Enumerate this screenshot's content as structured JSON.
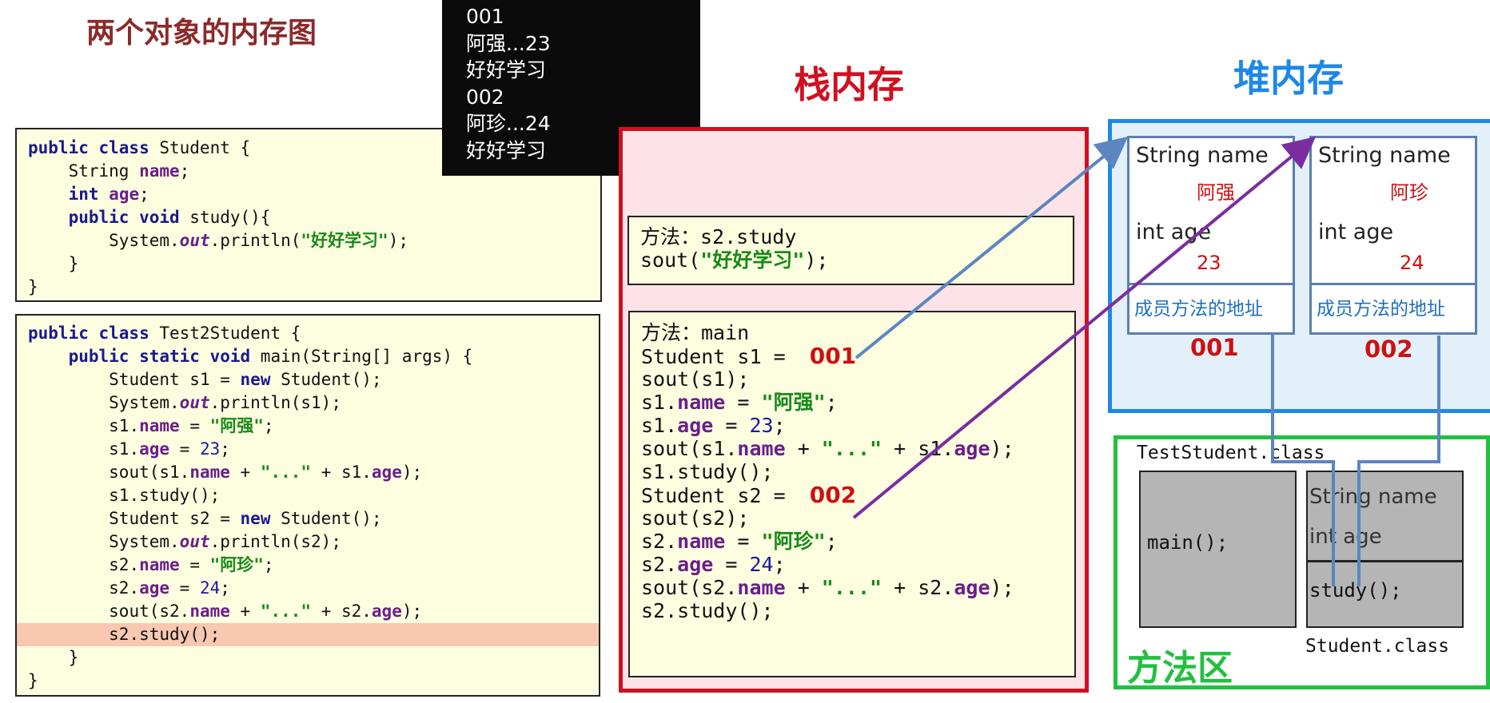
{
  "title": "两个对象的内存图",
  "console_lines": [
    "001",
    "阿强...23",
    "好好学习",
    "002",
    "阿珍...24",
    "好好学习"
  ],
  "code_student": {
    "l1_kw": "public class",
    "l1_name": " Student {",
    "l2_type": "String ",
    "l2_field": "name",
    "l2_end": ";",
    "l3_type": "int",
    "l3_field": "age",
    "l3_end": ";",
    "l4_kw": "public void",
    "l4_rest": " study(){",
    "l5_a": "System.",
    "l5_out": "out",
    "l5_b": ".println(",
    "l5_str": "\"好好学习\"",
    "l5_end": ");",
    "l6": "}",
    "l7": "}"
  },
  "code_test": {
    "l1_kw": "public class",
    "l1_name": " Test2Student {",
    "l2_kw": "public static void",
    "l2_rest": " main(String[] args) {",
    "l3_a": "Student s1 = ",
    "l3_kw": "new",
    "l3_b": " Student();",
    "l4_a": "System.",
    "l4_out": "out",
    "l4_b": ".println(s1);",
    "l5_a": "s1.",
    "l5_f": "name",
    "l5_b": " = ",
    "l5_s": "\"阿强\"",
    "l5_end": ";",
    "l6_a": "s1.",
    "l6_f": "age",
    "l6_b": " = ",
    "l6_n": "23",
    "l6_end": ";",
    "l7_a": "sout(s1.",
    "l7_f": "name",
    "l7_b": " + ",
    "l7_s": "\"...\"",
    "l7_c": " + s1.",
    "l7_f2": "age",
    "l7_end": ");",
    "l8": "s1.study();",
    "l9_a": "Student s2 = ",
    "l9_kw": "new",
    "l9_b": " Student();",
    "l10_a": "System.",
    "l10_out": "out",
    "l10_b": ".println(s2);",
    "l11_a": "s2.",
    "l11_f": "name",
    "l11_b": " = ",
    "l11_s": "\"阿珍\"",
    "l11_end": ";",
    "l12_a": "s2.",
    "l12_f": "age",
    "l12_b": " = ",
    "l12_n": "24",
    "l12_end": ";",
    "l13_a": "sout(s2.",
    "l13_f": "name",
    "l13_b": " + ",
    "l13_s": "\"...\"",
    "l13_c": " + s2.",
    "l13_f2": "age",
    "l13_end": ");",
    "l14": "s2.study();",
    "l15": "}",
    "l16": "}"
  },
  "stack": {
    "title": "栈内存",
    "frame_study": {
      "l1": "方法：s2.study",
      "l2_a": "sout(",
      "l2_s": "\"好好学习\"",
      "l2_end": ");"
    },
    "frame_main": {
      "l1": "方法：main",
      "l2_a": "Student s1 = ",
      "l2_ptr": "001",
      "l3": "sout(s1);",
      "l4_a": "s1.",
      "l4_f": "name",
      "l4_b": " = ",
      "l4_s": "\"阿强\"",
      "l4_end": ";",
      "l5_a": "s1.",
      "l5_f": "age",
      "l5_b": " = ",
      "l5_n": "23",
      "l5_end": ";",
      "l6_a": "sout(s1.",
      "l6_f": "name",
      "l6_b": " + ",
      "l6_s": "\"...\"",
      "l6_c": " + s1.",
      "l6_f2": "age",
      "l6_end": ");",
      "l7": "s1.study();",
      "l8_a": "Student s2 = ",
      "l8_ptr": "002",
      "l9": "sout(s2);",
      "l10_a": "s2.",
      "l10_f": "name",
      "l10_b": " = ",
      "l10_s": "\"阿珍\"",
      "l10_end": ";",
      "l11_a": "s2.",
      "l11_f": "age",
      "l11_b": " = ",
      "l11_n": "24",
      "l11_end": ";",
      "l12_a": "sout(s2.",
      "l12_f": "name",
      "l12_b": " + ",
      "l12_s": "\"...\"",
      "l12_c": " + s2.",
      "l12_f2": "age",
      "l12_end": ");",
      "l13": "s2.study();"
    }
  },
  "heap": {
    "title": "堆内存",
    "objects": [
      {
        "field1": "String name",
        "value1": "阿强",
        "field2": "int age",
        "value2": "23",
        "method_addr": "成员方法的地址",
        "address": "001"
      },
      {
        "field1": "String name",
        "value1": "阿珍",
        "field2": "int age",
        "value2": "24",
        "method_addr": "成员方法的地址",
        "address": "002"
      }
    ]
  },
  "method_area": {
    "title": "方法区",
    "test_class": "TestStudent.class",
    "main_method": "main();",
    "student_field1": "String name",
    "student_field2": "int age",
    "student_method": "study();",
    "student_class": "Student.class"
  },
  "colors": {
    "stack_border": "#d01020",
    "stack_bg": "#fde3e7",
    "heap_border": "#1e88e5",
    "heap_bg": "#e3f0fa",
    "method_border": "#22c040",
    "arrow_s1": "#5b86c0",
    "arrow_s2": "#7b2da0"
  }
}
